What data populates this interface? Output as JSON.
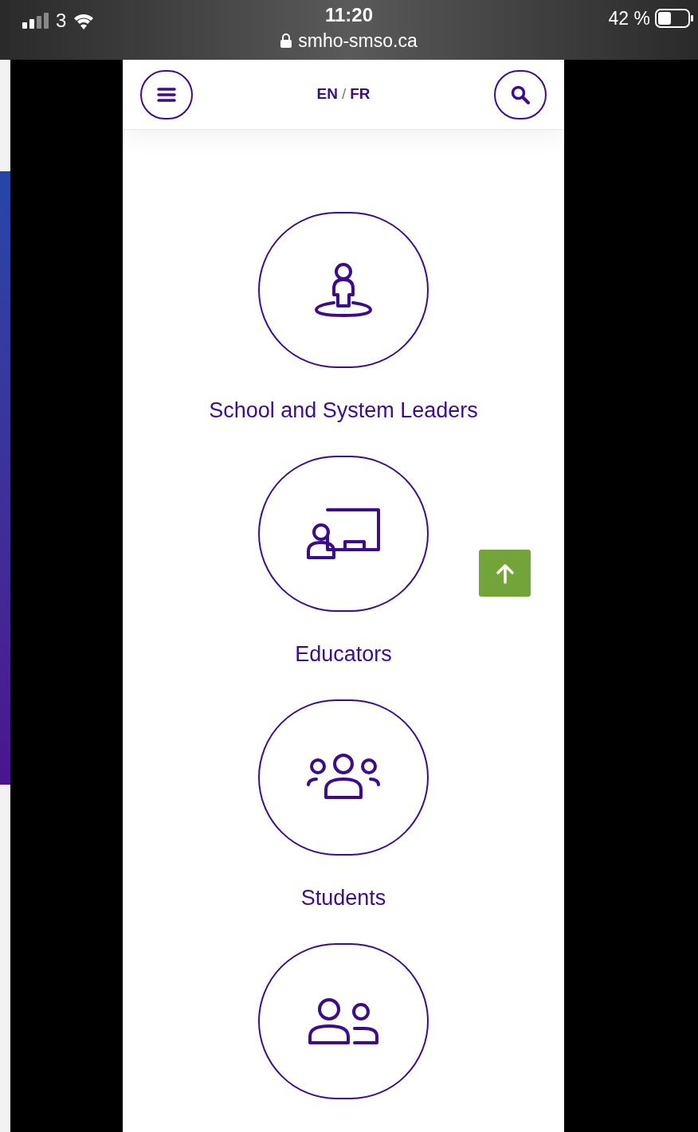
{
  "status_bar": {
    "carrier": "3",
    "time": "11:20",
    "url": "smho-smso.ca",
    "battery": "42 %"
  },
  "header": {
    "languages": [
      "EN",
      "FR"
    ],
    "separator": "/"
  },
  "audiences": [
    {
      "kind": "leader",
      "label": "School and System Leaders"
    },
    {
      "kind": "educator",
      "label": "Educators"
    },
    {
      "kind": "students",
      "label": "Students"
    },
    {
      "kind": "pair"
    }
  ]
}
